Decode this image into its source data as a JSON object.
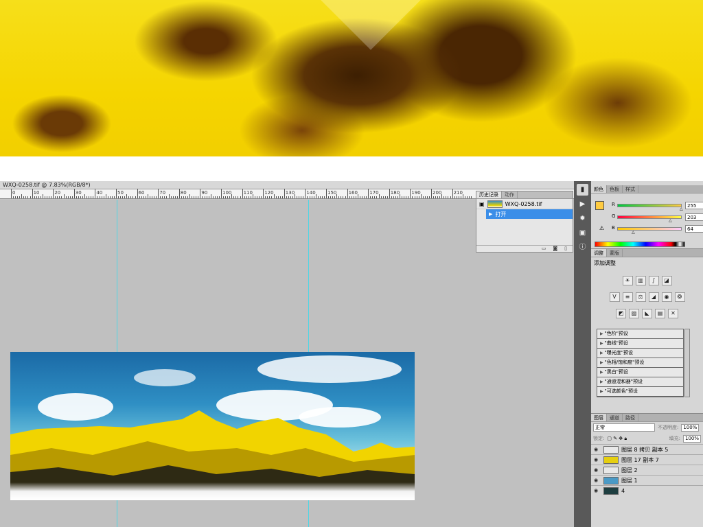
{
  "document": {
    "tab_title": "WXQ-0258.tif @ 7.83%(RGB/8*)",
    "ruler_labels": [
      "0",
      "10",
      "20",
      "30",
      "40",
      "50",
      "60",
      "70",
      "80",
      "90",
      "100",
      "110",
      "120",
      "130",
      "140",
      "150",
      "160",
      "170",
      "180",
      "190",
      "200",
      "210"
    ]
  },
  "history_panel": {
    "tabs": [
      "历史记录",
      "动作"
    ],
    "snapshot_label": "WXQ-0258.tif",
    "step_label": "打开"
  },
  "color_panel": {
    "tabs": [
      "颜色",
      "色板",
      "样式"
    ],
    "foreground": "#ffcb40",
    "channels": [
      {
        "label": "R",
        "value": "255"
      },
      {
        "label": "G",
        "value": "203"
      },
      {
        "label": "B",
        "value": "64"
      }
    ]
  },
  "adjustments_panel": {
    "tabs": [
      "调整",
      "蒙版"
    ],
    "title": "添加调整",
    "presets": [
      "\"色阶\"预设",
      "\"曲线\"预设",
      "\"曝光度\"预设",
      "\"色相/饱和度\"预设",
      "\"黑白\"预设",
      "\"通道混和器\"预设",
      "\"可选颜色\"预设"
    ]
  },
  "layers_panel": {
    "tabs": [
      "图层",
      "通道",
      "路径"
    ],
    "blend_mode": "正常",
    "opacity_label": "不透明度:",
    "opacity_value": "100%",
    "lock_label": "锁定:",
    "fill_label": "填充:",
    "fill_value": "100%",
    "layers": [
      {
        "name": "图层 8 拷贝 副本 5",
        "thumb": "#e8e8e8"
      },
      {
        "name": "图层 17 副本 7",
        "thumb": "#e6cf10"
      },
      {
        "name": "图层 2",
        "thumb": "#e8e8e8"
      },
      {
        "name": "图层 1",
        "thumb": "#4a9ac6"
      },
      {
        "name": "4",
        "thumb": "#1e3e40"
      }
    ]
  }
}
